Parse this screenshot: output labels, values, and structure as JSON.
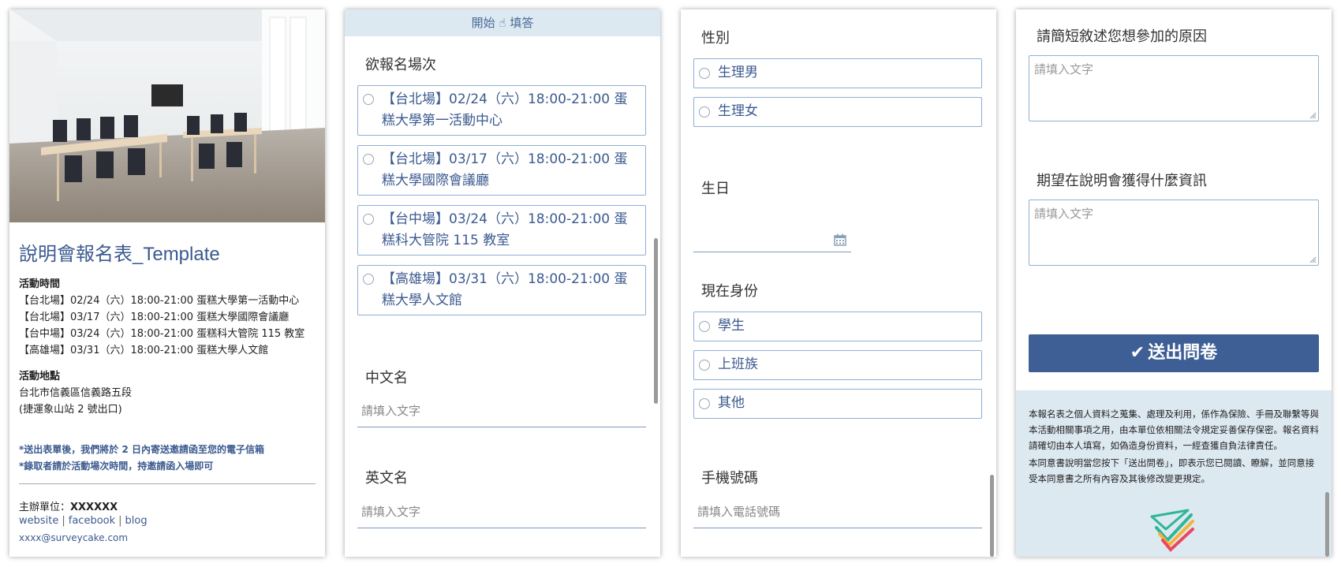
{
  "panel1": {
    "title": "說明會報名表_Template",
    "time_heading": "活動時間",
    "time_lines": [
      "【台北場】02/24（六）18:00-21:00  蛋糕大學第一活動中心",
      "【台北場】03/17（六）18:00-21:00  蛋糕大學國際會議廳",
      "【台中場】03/24（六）18:00-21:00  蛋糕科大管院 115 教室",
      "【高雄場】03/31（六）18:00-21:00 蛋糕大學人文館"
    ],
    "place_heading": "活動地點",
    "place_lines": [
      "台北市信義區信義路五段",
      "(捷運象山站 2 號出口)"
    ],
    "notes": [
      "*送出表單後，我們將於 2 日內寄送邀請函至您的電子信箱",
      "*錄取者請於活動場次時間，持邀請函入場即可"
    ],
    "org_label": "主辦單位：",
    "org_value": "XXXXXX",
    "links": [
      "website",
      "facebook",
      "blog"
    ],
    "email": "xxxx@surveycake.com"
  },
  "panel2": {
    "top_bar": "開始 ☝ 填答",
    "session_label": "欲報名場次",
    "sessions": [
      "【台北場】02/24（六）18:00-21:00 蛋糕大學第一活動中心",
      "【台北場】03/17（六）18:00-21:00 蛋糕大學國際會議廳",
      "【台中場】03/24（六）18:00-21:00 蛋糕科大管院 115 教室",
      "【高雄場】03/31（六）18:00-21:00 蛋糕大學人文館"
    ],
    "cn_name_label": "中文名",
    "cn_name_placeholder": "請填入文字",
    "en_name_label": "英文名",
    "en_name_placeholder": "請填入文字"
  },
  "panel3": {
    "gender_label": "性別",
    "gender_options": [
      "生理男",
      "生理女"
    ],
    "birthday_label": "生日",
    "status_label": "現在身份",
    "status_options": [
      "學生",
      "上班族",
      "其他"
    ],
    "phone_label": "手機號碼",
    "phone_placeholder": "請填入電話號碼"
  },
  "panel4": {
    "reason_label": "請簡短敘述您想參加的原因",
    "reason_placeholder": "請填入文字",
    "expect_label": "期望在說明會獲得什麼資訊",
    "expect_placeholder": "請填入文字",
    "submit_label": "送出問卷",
    "privacy_1": "本報名表之個人資料之蒐集、處理及利用，係作為保險、手冊及聯繫等與本活動相關事項之用，由本單位依相關法令規定妥善保存保密。報名資料請確切由本人填寫，如偽造身份資料，一經查獲自負法律責任。",
    "privacy_2": "本同意書說明當您按下「送出問卷」，即表示您已閱讀、瞭解，並同意接受本同意書之所有內容及其後修改變更規定。"
  },
  "colors": {
    "accent": "#3e5f95",
    "link": "#3b5a8f",
    "footer_bg": "#dde9f1",
    "border": "#8fb0d2"
  }
}
